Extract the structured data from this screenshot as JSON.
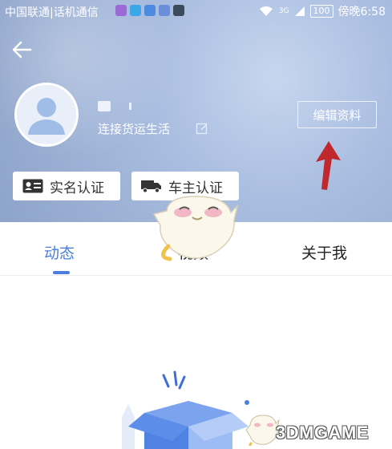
{
  "status_bar": {
    "carrier": "中国联通|话机通信",
    "network": "3G",
    "battery": "100",
    "time": "傍晚6:58"
  },
  "header": {
    "back_icon": "arrow-left-icon",
    "signature": "连接货运生活",
    "edit_profile_label": "编辑资料",
    "verify_realname_label": "实名认证",
    "verify_car_owner_label": "车主认证"
  },
  "tabs": [
    {
      "label": "动态",
      "active": true
    },
    {
      "label": "视频",
      "active": false
    },
    {
      "label": "关于我",
      "active": false
    }
  ],
  "colors": {
    "accent": "#4a7fe0",
    "annotation_arrow": "#c0282d"
  },
  "watermark": {
    "text": "3DMGAME"
  }
}
